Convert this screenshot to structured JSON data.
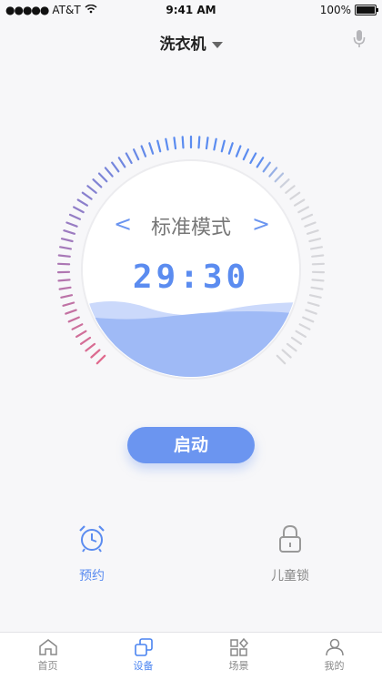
{
  "status_bar": {
    "carrier": "AT&T",
    "time": "9:41 AM",
    "battery": "100%"
  },
  "navbar": {
    "title": "洗衣机",
    "dropdown_icon": "chevron-down-icon",
    "voice_icon": "microphone-icon"
  },
  "dial": {
    "mode": "标准模式",
    "time": "29:30",
    "prev_icon": "chevron-left-icon",
    "next_icon": "chevron-right-icon"
  },
  "actions": {
    "start_label": "启动"
  },
  "features": [
    {
      "label": "预约",
      "icon": "alarm-clock-icon",
      "active": true
    },
    {
      "label": "儿童锁",
      "icon": "lock-icon",
      "active": false
    }
  ],
  "tabbar": [
    {
      "label": "首页",
      "icon": "home-icon",
      "active": false
    },
    {
      "label": "设备",
      "icon": "device-icon",
      "active": true
    },
    {
      "label": "场景",
      "icon": "scene-icon",
      "active": false
    },
    {
      "label": "我的",
      "icon": "user-icon",
      "active": false
    }
  ],
  "colors": {
    "accent": "#5b8cf0",
    "accent_light": "#6b95f0",
    "pink": "#e06a8d",
    "inactive_tick": "#d6d6da"
  }
}
